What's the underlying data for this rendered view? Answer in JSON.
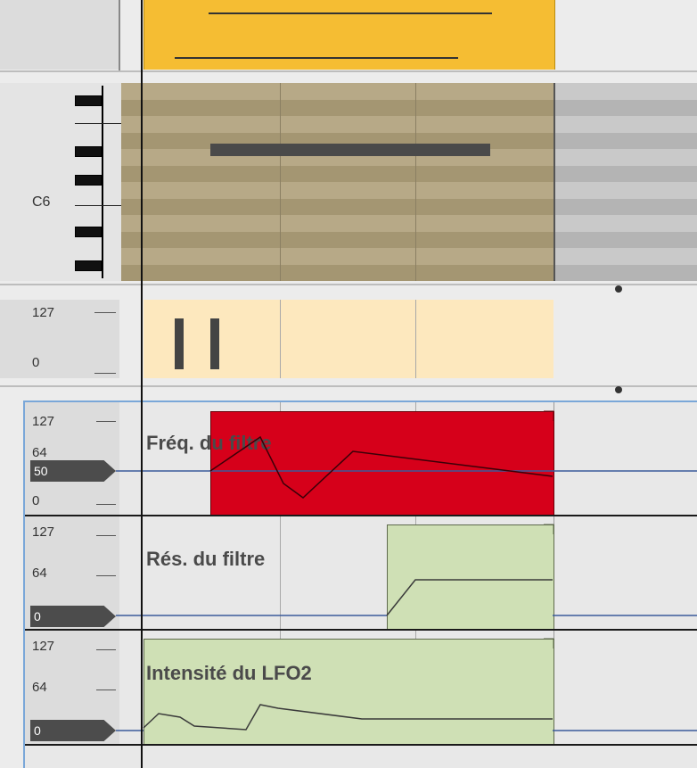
{
  "colors": {
    "clip_yellow": "#f5bd33",
    "red": "#d6001a",
    "green": "#cfe0b5",
    "automation_line": "#3a5a9a"
  },
  "piano": {
    "note_label": "C6"
  },
  "velocity": {
    "max_label": "127",
    "min_label": "0"
  },
  "lanes": [
    {
      "title": "Fréq. du filtre",
      "scale_top": "127",
      "scale_mid": "64",
      "scale_bottom": "0",
      "value": "50"
    },
    {
      "title": "Rés. du filtre",
      "scale_top": "127",
      "scale_mid": "64",
      "value": "0"
    },
    {
      "title": "Intensité du LFO2",
      "scale_top": "127",
      "scale_mid": "64",
      "value": "0"
    }
  ],
  "icons": [
    "resize-handle-icon",
    "resize-handle-icon"
  ]
}
